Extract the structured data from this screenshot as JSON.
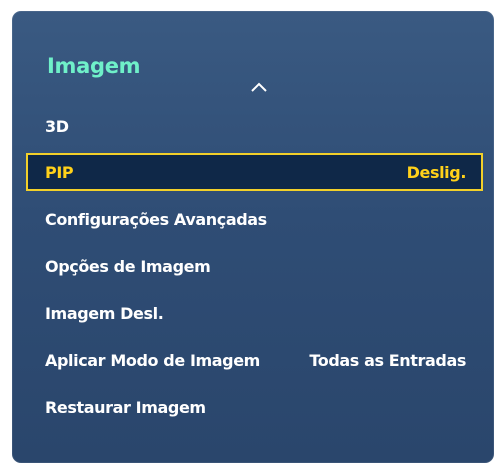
{
  "menu": {
    "title": "Imagem",
    "items": [
      {
        "label": "3D",
        "value": ""
      },
      {
        "label": "PIP",
        "value": "Deslig."
      },
      {
        "label": "Configurações Avançadas",
        "value": ""
      },
      {
        "label": "Opções de Imagem",
        "value": ""
      },
      {
        "label": "Imagem Desl.",
        "value": ""
      },
      {
        "label": "Aplicar Modo de Imagem",
        "value": "Todas as Entradas"
      },
      {
        "label": "Restaurar Imagem",
        "value": ""
      }
    ]
  },
  "colors": {
    "panel": "#2f4d75",
    "title": "#6ff0c9",
    "selected_background": "#0f2848",
    "selected_border": "#f2d02a",
    "selected_text": "#ffd11a",
    "text": "#ffffff"
  },
  "icons": {
    "scroll_up": "chevron-up-icon"
  }
}
